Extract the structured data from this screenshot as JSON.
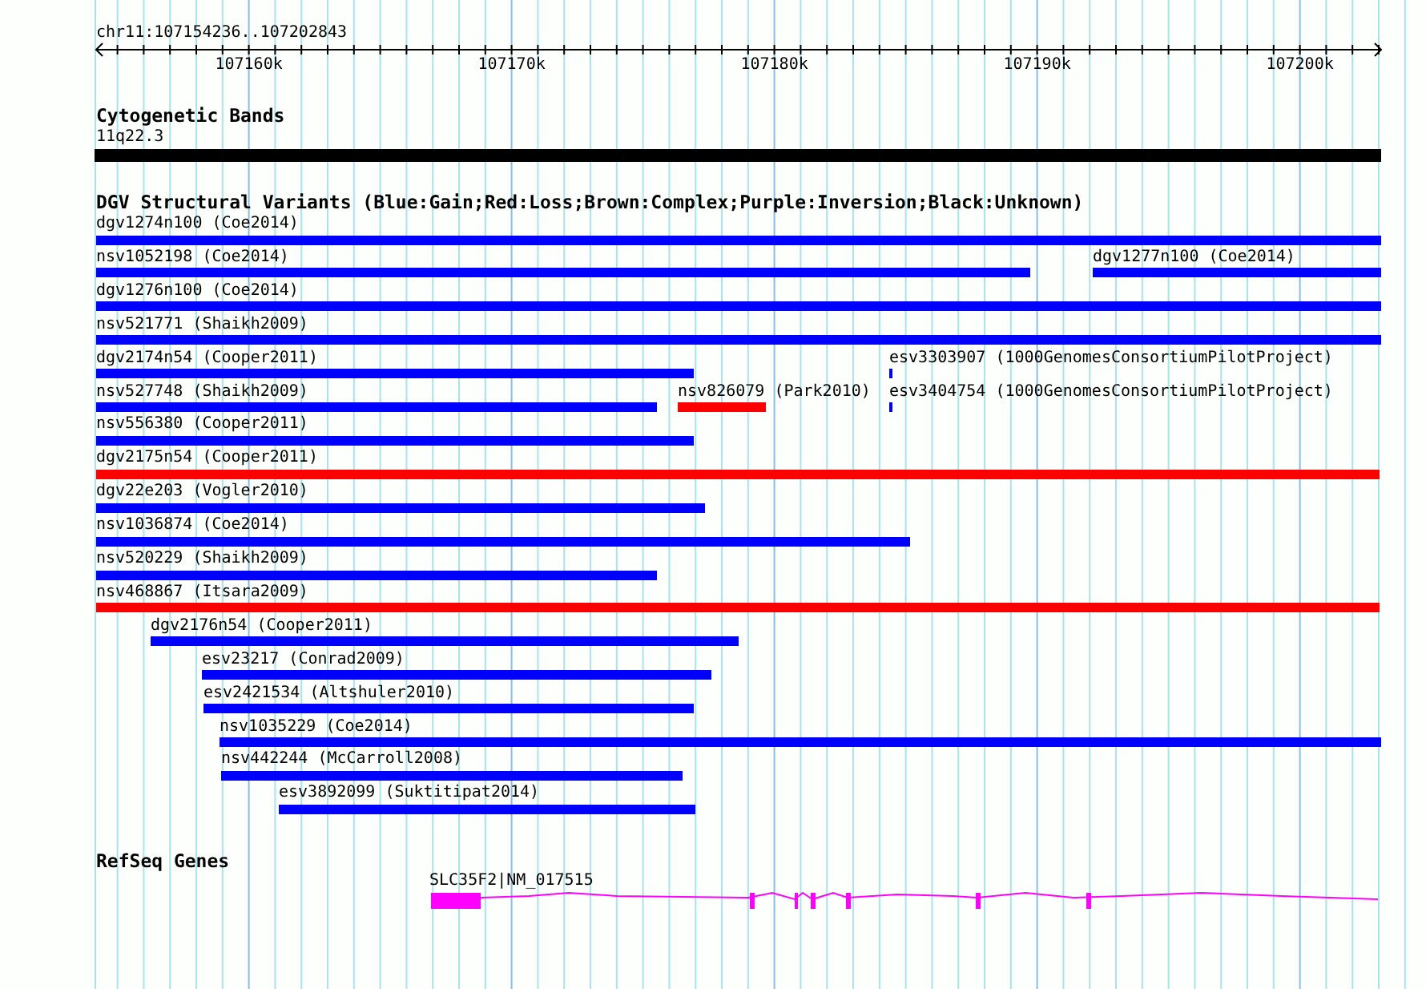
{
  "ruler": {
    "location": "chr11:107154236..107202843",
    "tick_labels": [
      "107160k",
      "107170k",
      "107180k",
      "107190k",
      "107200k"
    ]
  },
  "cytogenetic_bands": {
    "title": "Cytogenetic Bands",
    "bands": [
      {
        "label": "11q22.3",
        "color": "#000000"
      }
    ]
  },
  "dgv_track": {
    "title": "DGV Structural Variants (Blue:Gain;Red:Loss;Brown:Complex;Purple:Inversion;Black:Unknown)",
    "rows": [
      {
        "features": [
          {
            "label": "dgv1274n100 (Coe2014)",
            "color": "#0000ff"
          }
        ]
      },
      {
        "features": [
          {
            "label": "nsv1052198 (Coe2014)",
            "color": "#0000ff"
          },
          {
            "label": "dgv1277n100 (Coe2014)",
            "color": "#0000ff"
          }
        ]
      },
      {
        "features": [
          {
            "label": "dgv1276n100 (Coe2014)",
            "color": "#0000ff"
          }
        ]
      },
      {
        "features": [
          {
            "label": "nsv521771 (Shaikh2009)",
            "color": "#0000ff"
          }
        ]
      },
      {
        "features": [
          {
            "label": "dgv2174n54 (Cooper2011)",
            "color": "#0000ff"
          },
          {
            "label": "esv3303907 (1000GenomesConsortiumPilotProject)",
            "color": "#0000ff"
          }
        ]
      },
      {
        "features": [
          {
            "label": "nsv527748 (Shaikh2009)",
            "color": "#0000ff"
          },
          {
            "label": "nsv826079 (Park2010)",
            "color": "#ff0000"
          },
          {
            "label": "esv3404754 (1000GenomesConsortiumPilotProject)",
            "color": "#0000ff"
          }
        ]
      },
      {
        "features": [
          {
            "label": "nsv556380 (Cooper2011)",
            "color": "#0000ff"
          }
        ]
      },
      {
        "features": [
          {
            "label": "dgv2175n54 (Cooper2011)",
            "color": "#ff0000"
          }
        ]
      },
      {
        "features": [
          {
            "label": "dgv22e203 (Vogler2010)",
            "color": "#0000ff"
          }
        ]
      },
      {
        "features": [
          {
            "label": "nsv1036874 (Coe2014)",
            "color": "#0000ff"
          }
        ]
      },
      {
        "features": [
          {
            "label": "nsv520229 (Shaikh2009)",
            "color": "#0000ff"
          }
        ]
      },
      {
        "features": [
          {
            "label": "nsv468867 (Itsara2009)",
            "color": "#ff0000"
          }
        ]
      },
      {
        "features": [
          {
            "label": "dgv2176n54 (Cooper2011)",
            "color": "#0000ff"
          }
        ]
      },
      {
        "features": [
          {
            "label": "esv23217 (Conrad2009)",
            "color": "#0000ff"
          }
        ]
      },
      {
        "features": [
          {
            "label": "esv2421534 (Altshuler2010)",
            "color": "#0000ff"
          }
        ]
      },
      {
        "features": [
          {
            "label": "nsv1035229 (Coe2014)",
            "color": "#0000ff"
          }
        ]
      },
      {
        "features": [
          {
            "label": "nsv442244 (McCarroll2008)",
            "color": "#0000ff"
          }
        ]
      },
      {
        "features": [
          {
            "label": "esv3892099 (Suktitipat2014)",
            "color": "#0000ff"
          }
        ]
      }
    ]
  },
  "refseq_track": {
    "title": "RefSeq Genes",
    "genes": [
      {
        "label": "SLC35F2|NM_017515",
        "color": "#ff00ff"
      }
    ]
  }
}
